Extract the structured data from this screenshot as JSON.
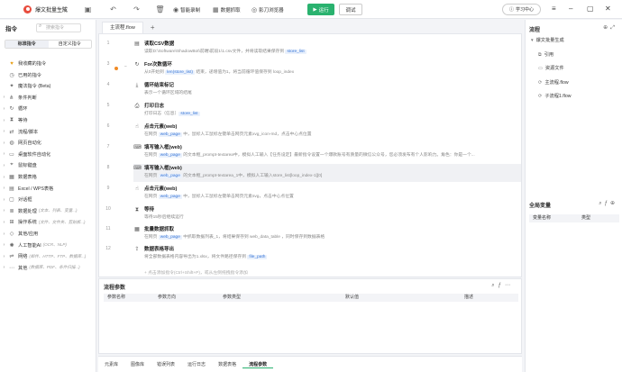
{
  "titlebar": {
    "app_title": "爆文批量生成",
    "smart_record": "智能录制",
    "data_scrape": "数据抓取",
    "shadow_browser": "影刀浏览器",
    "run": "运行",
    "debug": "调试",
    "learning_center": "学习中心"
  },
  "left": {
    "title": "指令",
    "search_placeholder": "搜索指令",
    "tabs": [
      "标准指令",
      "自定义指令"
    ],
    "categories": [
      {
        "label": "我收藏的指令",
        "sub": "",
        "icon": "heart-icon",
        "arrow": false
      },
      {
        "label": "已用的指令",
        "sub": "",
        "icon": "clock-icon",
        "arrow": false
      },
      {
        "label": "魔法指令 (Beta)",
        "sub": "",
        "icon": "magic-icon",
        "arrow": false
      },
      {
        "label": "条件判断",
        "sub": "",
        "icon": "branch-icon",
        "arrow": true
      },
      {
        "label": "循环",
        "sub": "",
        "icon": "loop-icon",
        "arrow": true
      },
      {
        "label": "等待",
        "sub": "",
        "icon": "hourglass-icon",
        "arrow": true
      },
      {
        "label": "流程/脚本",
        "sub": "",
        "icon": "flow-icon",
        "arrow": true
      },
      {
        "label": "网页自动化",
        "sub": "",
        "icon": "globe-icon",
        "arrow": true
      },
      {
        "label": "桌面软件自动化",
        "sub": "",
        "icon": "desktop-icon",
        "arrow": true
      },
      {
        "label": "鼠标键盘",
        "sub": "",
        "icon": "mouse-icon",
        "arrow": true
      },
      {
        "label": "数据表格",
        "sub": "",
        "icon": "table-icon",
        "arrow": true
      },
      {
        "label": "Excel / WPS表格",
        "sub": "",
        "icon": "excel-icon",
        "arrow": true
      },
      {
        "label": "对话框",
        "sub": "",
        "icon": "dialog-icon",
        "arrow": true
      },
      {
        "label": "数据处理",
        "sub": "(文本、列表、变量...)",
        "icon": "data-icon",
        "arrow": true
      },
      {
        "label": "操作系统",
        "sub": "(文件、文件夹、剪贴板...)",
        "icon": "os-icon",
        "arrow": true
      },
      {
        "label": "其他/应用",
        "sub": "",
        "icon": "app-icon",
        "arrow": true
      },
      {
        "label": "人工智能AI",
        "sub": "(OCR、NLP)",
        "icon": "ai-icon",
        "arrow": true
      },
      {
        "label": "网络",
        "sub": "(邮件、HTTP、FTP、数据库...)",
        "icon": "network-icon",
        "arrow": true
      },
      {
        "label": "其他",
        "sub": "(数据库、PDF、条件扫描...)",
        "icon": "more-icon",
        "arrow": true
      }
    ]
  },
  "editor": {
    "tab": "主流程.flow",
    "steps": [
      {
        "num": "1",
        "icon": "csv-icon",
        "title": "读取CSV数据",
        "desc": [
          "读取D:\\Software\\ShadowBot\\前端\\前段1\\1.csv文件，并将读取结果保存到 ",
          "store_list",
          ""
        ],
        "indent": 0
      },
      {
        "num": "3",
        "icon": "loop-icon",
        "title": "For次数循环",
        "desc": [
          "从0开始到 ",
          "len(store_list)",
          " 结束，递增值为1，将当前循环值保存到 ",
          "loop_index",
          ""
        ],
        "indent": 0
      },
      {
        "num": "4",
        "icon": "loop-end-icon",
        "title": "循环结束标记",
        "desc": [
          "表示一个循环区域的结尾",
          "",
          ""
        ],
        "indent": 0
      },
      {
        "num": "5",
        "icon": "print-icon",
        "title": "打印日志",
        "desc": [
          "打印日志（信息）",
          "store_list",
          ""
        ],
        "indent": 0
      },
      {
        "num": "6",
        "icon": "click-icon",
        "title": "点击元素(web)",
        "desc": [
          "在网页 ",
          "web_page",
          " 中，鼠标人工鼠标左键单击网页元素xvg_icon-md，点击中心点位置"
        ],
        "indent": 0
      },
      {
        "num": "7",
        "icon": "input-icon",
        "title": "填写输入框(web)",
        "desc": [
          "在网页 ",
          "web_page",
          " 的文本框_prompt-textarea中，模拟人工输入【任务设定】最新指令设置一个爆款账号有质量的微信公众号，您必须发布有个人影响力。角色：你是一个..."
        ],
        "indent": 0
      },
      {
        "num": "8",
        "icon": "input-icon",
        "title": "填写输入框(web)",
        "desc": [
          "在网页 ",
          "web_page",
          " 的文本框_prompt-textarea_1中，模拟人工输入store_list[loop_index-1][0]"
        ],
        "indent": 0
      },
      {
        "num": "9",
        "icon": "click-icon",
        "title": "点击元素(web)",
        "desc": [
          "在网页 ",
          "web_page",
          " 中，鼠标人工鼠标左键单击网页元素svg，点击中心点位置"
        ],
        "indent": 0
      },
      {
        "num": "10",
        "icon": "wait-icon",
        "title": "等待",
        "desc": [
          "等待15秒后继续运行",
          "",
          ""
        ],
        "indent": 0
      },
      {
        "num": "11",
        "icon": "scrape-icon",
        "title": "批量数据抓取",
        "desc": [
          "在网页 ",
          "web_page",
          " 中抓取数据列表_1，将结果保存到 ",
          "web_data_table",
          " ，同时保存到数据表格"
        ],
        "indent": 0
      },
      {
        "num": "12",
        "icon": "export-icon",
        "title": "数据表格导出",
        "desc": [
          "将全部数据表格内容导出为1.xlsx，将文件路径保存到 ",
          "file_path",
          ""
        ],
        "indent": 0
      }
    ],
    "hint": "+ 点击添加指令(Ctrl+Shift+P)，或从左侧拖拽指令添加"
  },
  "params": {
    "title": "流程参数",
    "columns": [
      "参数名称",
      "参数方向",
      "参数类型",
      "默认值",
      "描述"
    ]
  },
  "bottom_tabs": [
    "元素库",
    "图像库",
    "错误列表",
    "运行日志",
    "数据表格",
    "流程参数"
  ],
  "right": {
    "flow_title": "流程",
    "tree": [
      {
        "label": "爆文批量生成",
        "level": 0,
        "icon": "▾"
      },
      {
        "label": "引用",
        "level": 1,
        "icon": "⧉"
      },
      {
        "label": "资源文件",
        "level": 1,
        "icon": "▭"
      },
      {
        "label": "主流程.flow",
        "level": 1,
        "icon": "⟳"
      },
      {
        "label": "子流程1.flow",
        "level": 1,
        "icon": "⟳"
      }
    ],
    "globals_title": "全局变量",
    "globals_columns": [
      "变量名称",
      "类型"
    ]
  }
}
